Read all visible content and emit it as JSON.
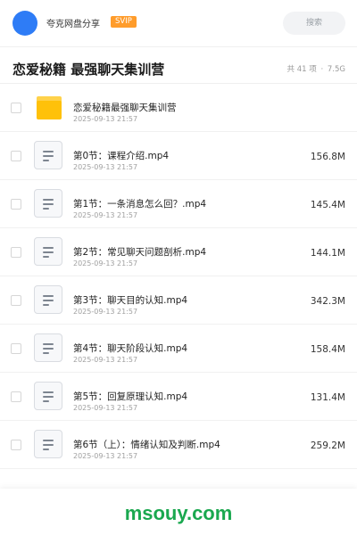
{
  "header": {
    "title": "夸克网盘分享",
    "badge": "SVIP",
    "search_label": "搜索",
    "avatar_color": "#2e7cf6",
    "badge_color": "#ff9c2b"
  },
  "folder": {
    "title": "恋爱秘籍 最强聊天集训营",
    "count": "共 41 项",
    "separator": "·",
    "total_size": "7.5G"
  },
  "files": [
    {
      "type": "folder",
      "icon": "folder-icon",
      "name": "恋爱秘籍最强聊天集训营",
      "date": "2025-09-13 21:57",
      "size": ""
    },
    {
      "type": "video",
      "icon": "file-icon",
      "name": "第0节：课程介绍.mp4",
      "date": "2025-09-13 21:57",
      "size": "156.8M"
    },
    {
      "type": "video",
      "icon": "file-icon",
      "name": "第1节：一条消息怎么回？.mp4",
      "date": "2025-09-13 21:57",
      "size": "145.4M"
    },
    {
      "type": "video",
      "icon": "file-icon",
      "name": "第2节：常见聊天问题剖析.mp4",
      "date": "2025-09-13 21:57",
      "size": "144.1M"
    },
    {
      "type": "video",
      "icon": "file-icon",
      "name": "第3节：聊天目的认知.mp4",
      "date": "2025-09-13 21:57",
      "size": "342.3M"
    },
    {
      "type": "video",
      "icon": "file-icon",
      "name": "第4节：聊天阶段认知.mp4",
      "date": "2025-09-13 21:57",
      "size": "158.4M"
    },
    {
      "type": "video",
      "icon": "file-icon",
      "name": "第5节：回复原理认知.mp4",
      "date": "2025-09-13 21:57",
      "size": "131.4M"
    },
    {
      "type": "video",
      "icon": "file-icon",
      "name": "第6节（上）：情绪认知及判断.mp4",
      "date": "2025-09-13 21:57",
      "size": "259.2M"
    }
  ],
  "watermark": {
    "text": "msouy.com",
    "color": "#1aa84f"
  }
}
